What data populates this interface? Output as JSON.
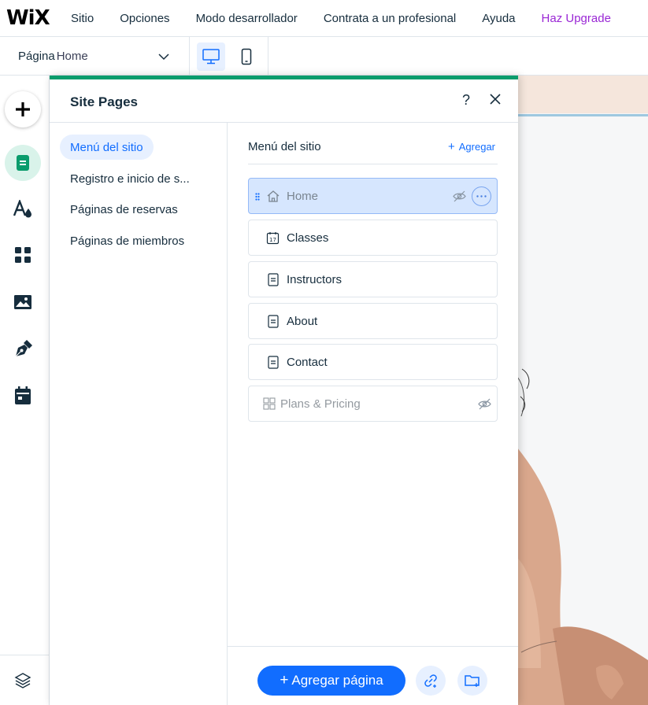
{
  "topbar": {
    "logo": "WiX",
    "menu": [
      "Sitio",
      "Opciones",
      "Modo desarrollador",
      "Contrata a un profesional",
      "Ayuda"
    ],
    "upgrade": "Haz Upgrade",
    "upgrade_color": "#9a27d5"
  },
  "page_selector": {
    "label": "Página",
    "value": "Home"
  },
  "device_toggle": {
    "selected": "desktop"
  },
  "rail": {
    "icons": [
      "add-icon",
      "pages-icon",
      "theme-icon",
      "apps-icon",
      "media-icon",
      "blog-icon",
      "bookings-icon",
      "layers-icon"
    ]
  },
  "panel": {
    "title": "Site Pages",
    "help": "?",
    "accent": "#0a9c6c",
    "categories": [
      {
        "label": "Menú del sitio",
        "active": true
      },
      {
        "label": "Registro e inicio de s..."
      },
      {
        "label": "Páginas de reservas"
      },
      {
        "label": "Páginas de miembros"
      }
    ],
    "list_title": "Menú del sitio",
    "list_add": "Agregar",
    "pages": [
      {
        "name": "Home",
        "icon": "home-icon",
        "selected": true,
        "hidden": true
      },
      {
        "name": "Classes",
        "icon": "calendar-icon"
      },
      {
        "name": "Instructors",
        "icon": "page-icon"
      },
      {
        "name": "About",
        "icon": "page-icon"
      },
      {
        "name": "Contact",
        "icon": "page-icon"
      },
      {
        "name": "Plans & Pricing",
        "icon": "plans-icon",
        "hidden": true
      }
    ],
    "add_page": "Agregar página"
  }
}
